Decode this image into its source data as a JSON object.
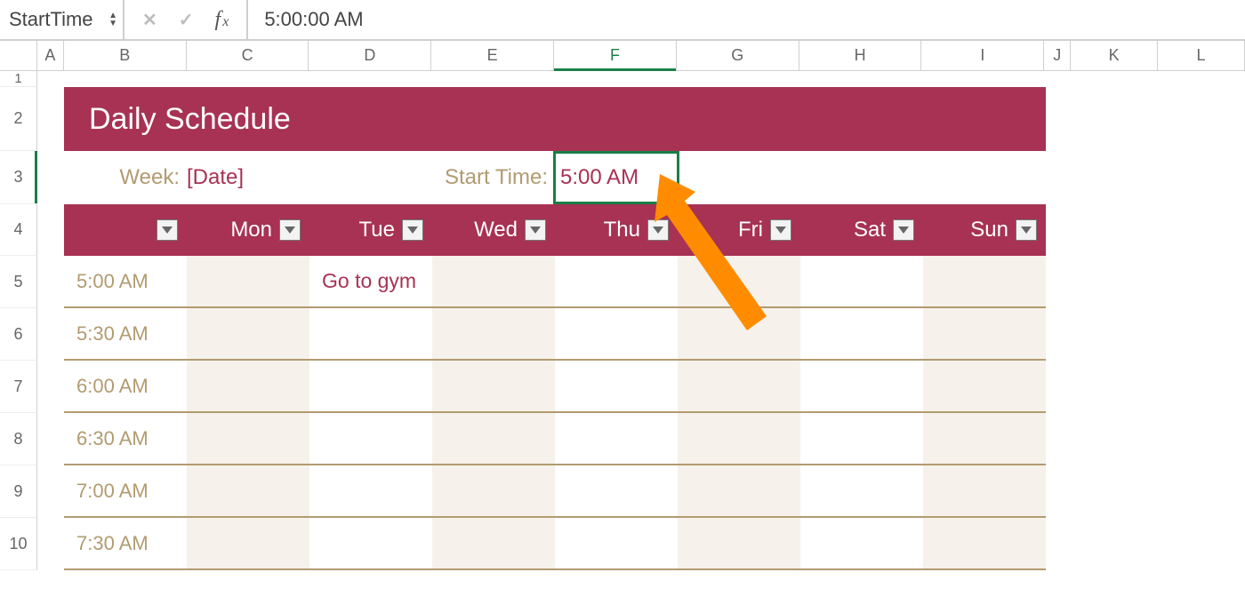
{
  "formula_bar": {
    "name_box": "StartTime",
    "cancel_icon": "✕",
    "confirm_icon": "✓",
    "value": "5:00:00 AM"
  },
  "columns": [
    "A",
    "B",
    "C",
    "D",
    "E",
    "F",
    "G",
    "H",
    "I",
    "J",
    "K",
    "L"
  ],
  "active_column": "F",
  "row_numbers": [
    "1",
    "2",
    "3",
    "4",
    "5",
    "6",
    "7",
    "8",
    "9",
    "10"
  ],
  "active_row": "3",
  "schedule": {
    "title": "Daily Schedule",
    "week_label": "Week:",
    "week_value": "[Date]",
    "start_time_label": "Start Time:",
    "start_time_value": "5:00 AM",
    "days": [
      "",
      "Mon",
      "Tue",
      "Wed",
      "Thu",
      "Fri",
      "Sat",
      "Sun"
    ],
    "slots": [
      {
        "time": "5:00 AM",
        "entries": [
          "",
          "Go to gym",
          "",
          "",
          "",
          "",
          ""
        ]
      },
      {
        "time": "5:30 AM",
        "entries": [
          "",
          "",
          "",
          "",
          "",
          "",
          ""
        ]
      },
      {
        "time": "6:00 AM",
        "entries": [
          "",
          "",
          "",
          "",
          "",
          "",
          ""
        ]
      },
      {
        "time": "6:30 AM",
        "entries": [
          "",
          "",
          "",
          "",
          "",
          "",
          ""
        ]
      },
      {
        "time": "7:00 AM",
        "entries": [
          "",
          "",
          "",
          "",
          "",
          "",
          ""
        ]
      },
      {
        "time": "7:30 AM",
        "entries": [
          "",
          "",
          "",
          "",
          "",
          "",
          ""
        ]
      }
    ]
  },
  "colors": {
    "brand": "#a73253",
    "tan": "#b29b70",
    "sel": "#1a7f46",
    "annot": "#ff8c00"
  }
}
